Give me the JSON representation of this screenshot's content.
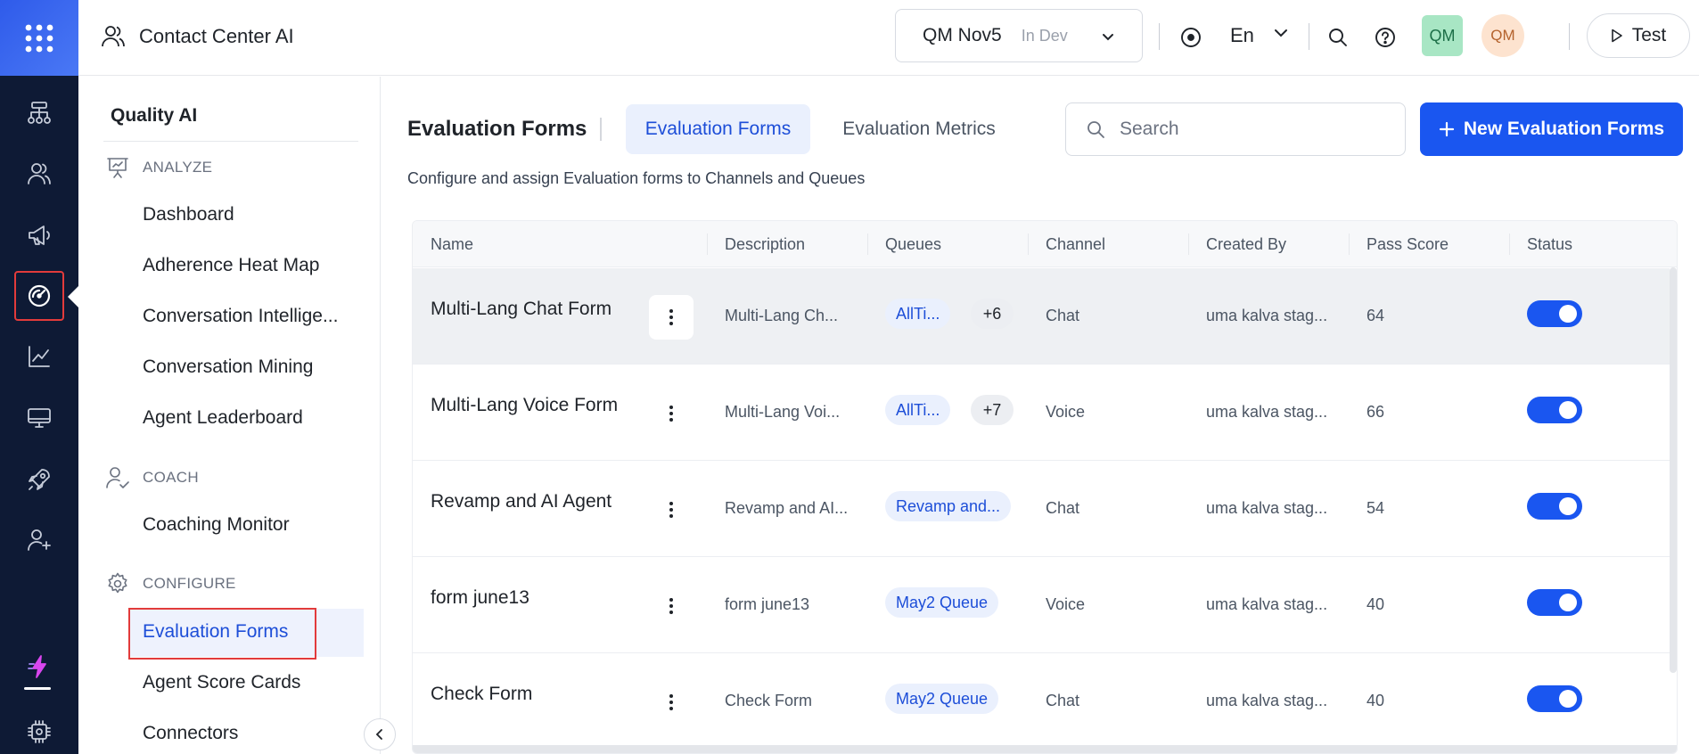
{
  "topbar": {
    "app_title": "Contact Center AI",
    "env_name": "QM Nov5",
    "env_tag": "In Dev",
    "language": "En",
    "user_badge_1": "QM",
    "user_badge_2": "QM",
    "test_label": "Test"
  },
  "rail": {
    "icons": [
      "flow-icon",
      "users-icon",
      "megaphone-icon",
      "gauge-icon",
      "chart-icon",
      "monitor-icon",
      "rocket-icon",
      "user-plus-icon",
      "bolt-icon",
      "chip-icon"
    ],
    "active": "gauge-icon"
  },
  "sidebar": {
    "title": "Quality AI",
    "sections": {
      "analyze": "ANALYZE",
      "coach": "COACH",
      "configure": "CONFIGURE"
    },
    "analyze_items": [
      "Dashboard",
      "Adherence Heat Map",
      "Conversation Intellige...",
      "Conversation Mining",
      "Agent Leaderboard"
    ],
    "coach_items": [
      "Coaching Monitor"
    ],
    "configure_items": [
      "Evaluation Forms",
      "Agent Score Cards",
      "Connectors"
    ],
    "active_item": "Evaluation Forms"
  },
  "main": {
    "title": "Evaluation Forms",
    "tabs": [
      {
        "label": "Evaluation Forms",
        "active": true
      },
      {
        "label": "Evaluation Metrics",
        "active": false
      }
    ],
    "search_placeholder": "Search",
    "new_button_label": "New Evaluation Forms",
    "subtitle": "Configure and assign Evaluation forms to Channels and Queues"
  },
  "table": {
    "columns": [
      "Name",
      "Description",
      "Queues",
      "Channel",
      "Created By",
      "Pass Score",
      "Status"
    ],
    "rows": [
      {
        "name": "Multi-Lang Chat Form",
        "description": "Multi-Lang Ch...",
        "queue": "AllTi...",
        "queue_more": "+6",
        "channel": "Chat",
        "created_by": "uma kalva stag...",
        "pass_score": "64",
        "status": true
      },
      {
        "name": "Multi-Lang Voice Form",
        "description": "Multi-Lang Voi...",
        "queue": "AllTi...",
        "queue_more": "+7",
        "channel": "Voice",
        "created_by": "uma kalva stag...",
        "pass_score": "66",
        "status": true
      },
      {
        "name": "Revamp and AI Agent",
        "description": "Revamp and AI...",
        "queue": "Revamp and...",
        "queue_more": "",
        "channel": "Chat",
        "created_by": "uma kalva stag...",
        "pass_score": "54",
        "status": true
      },
      {
        "name": "form june13",
        "description": "form june13",
        "queue": "May2 Queue",
        "queue_more": "",
        "channel": "Voice",
        "created_by": "uma kalva stag...",
        "pass_score": "40",
        "status": true
      },
      {
        "name": "Check Form",
        "description": "Check Form",
        "queue": "May2 Queue",
        "queue_more": "",
        "channel": "Chat",
        "created_by": "uma kalva stag...",
        "pass_score": "40",
        "status": true
      }
    ]
  },
  "colors": {
    "rail_bg": "#0e1a35",
    "accent": "#1a56f0",
    "highlight_box": "#e23b3b"
  }
}
